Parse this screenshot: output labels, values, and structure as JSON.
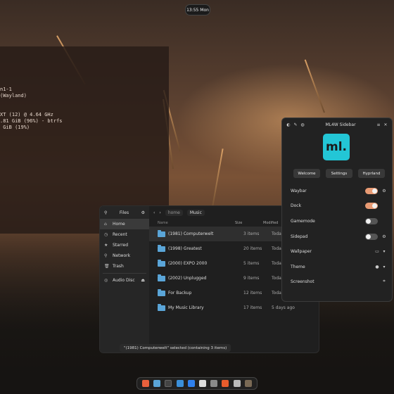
{
  "clock": {
    "time": "13:55 Mon"
  },
  "terminal": {
    "lines": [
      "n1-1",
      "(Wayland)",
      "XT (12) @ 4.64 GHz",
      ".81 GiB (96%) - btrfs",
      " GiB (19%)"
    ]
  },
  "files": {
    "title": "Files",
    "sidebar": [
      {
        "label": "Home",
        "icon": "home-icon",
        "glyph": "⌂",
        "selected": true
      },
      {
        "label": "Recent",
        "icon": "clock-icon",
        "glyph": "◷"
      },
      {
        "label": "Starred",
        "icon": "star-icon",
        "glyph": "★"
      },
      {
        "label": "Network",
        "icon": "network-icon",
        "glyph": "⚲"
      },
      {
        "label": "Trash",
        "icon": "trash-icon",
        "glyph": "🗑"
      },
      {
        "label": "Audio Disc",
        "icon": "disc-icon",
        "glyph": "◎"
      }
    ],
    "breadcrumb": {
      "home": "home",
      "current": "Music"
    },
    "columns": {
      "name": "Name",
      "size": "Size",
      "modified": "Modified"
    },
    "rows": [
      {
        "name": "(1981) Computerwelt",
        "size": "3 items",
        "modified": "Today",
        "selected": true
      },
      {
        "name": "(1998) Greatest",
        "size": "20 items",
        "modified": "Today"
      },
      {
        "name": "(2000) EXPO 2000",
        "size": "5 items",
        "modified": "Today"
      },
      {
        "name": "(2002) Unplugged",
        "size": "9 items",
        "modified": "Today"
      },
      {
        "name": "For Backup",
        "size": "12 items",
        "modified": "Today"
      },
      {
        "name": "My Music Library",
        "size": "17 items",
        "modified": "5 days ago"
      }
    ],
    "status": "\"(1981) Computerwelt\" selected  (containing 3 items)"
  },
  "sidebar_app": {
    "title": "ML4W Sidebar",
    "logo_text": "ml.",
    "tabs": [
      "Welcome",
      "Settings",
      "Hyprland"
    ],
    "options": [
      {
        "label": "Waybar",
        "type": "toggle",
        "on": true,
        "gear": true
      },
      {
        "label": "Dock",
        "type": "toggle",
        "on": true
      },
      {
        "label": "Gamemode",
        "type": "toggle",
        "on": false
      },
      {
        "label": "Sidepad",
        "type": "toggle",
        "on": false,
        "gear": true
      },
      {
        "label": "Wallpaper",
        "type": "action"
      },
      {
        "label": "Theme",
        "type": "action"
      },
      {
        "label": "Screenshot",
        "type": "action"
      }
    ]
  },
  "dock": {
    "apps": [
      {
        "name": "firefox",
        "color": "#e8603c"
      },
      {
        "name": "files",
        "color": "#5aa5d8"
      },
      {
        "name": "terminal",
        "color": "#444444"
      },
      {
        "name": "store",
        "color": "#3b8fd9"
      },
      {
        "name": "code",
        "color": "#2f80ed"
      },
      {
        "name": "settings",
        "color": "#dddddd"
      },
      {
        "name": "tweaks",
        "color": "#8a8a8a"
      },
      {
        "name": "app-red",
        "color": "#e85c2c"
      },
      {
        "name": "app-grey",
        "color": "#bbbbbb"
      },
      {
        "name": "app-grid",
        "color": "#7a6a55"
      }
    ]
  },
  "colors": {
    "accent": "#e89a73",
    "logo": "#23c6d6",
    "folder": "#5aa5d8"
  }
}
